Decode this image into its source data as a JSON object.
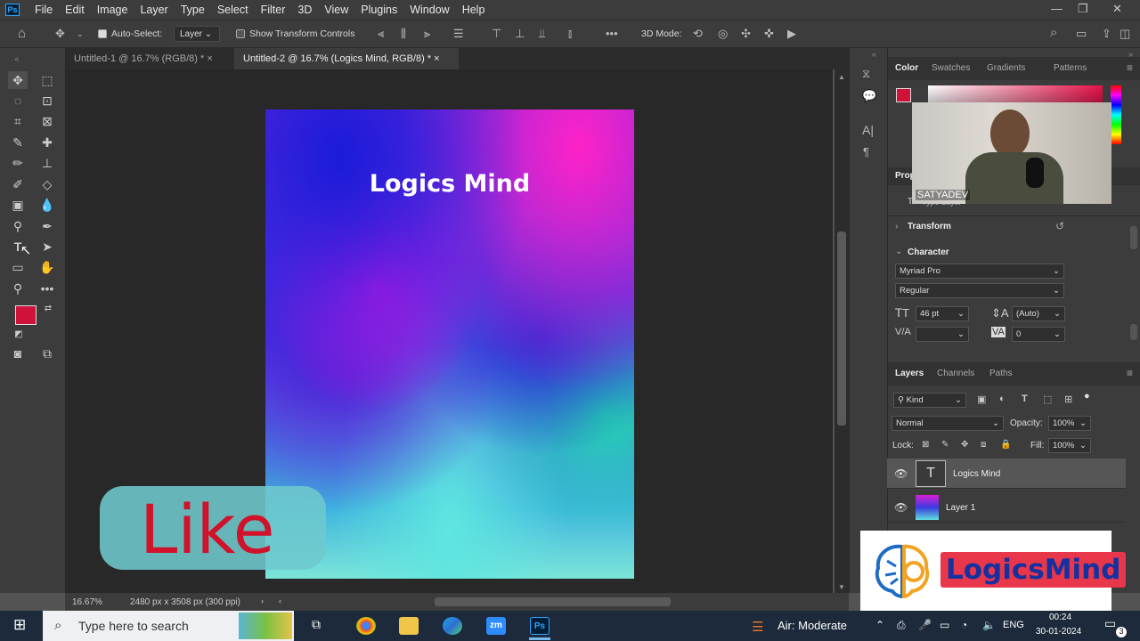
{
  "app": {
    "logo": "Ps",
    "menu": [
      "File",
      "Edit",
      "Image",
      "Layer",
      "Type",
      "Select",
      "Filter",
      "3D",
      "View",
      "Plugins",
      "Window",
      "Help"
    ],
    "window_controls": [
      "minimize-icon",
      "restore-icon",
      "close-icon"
    ]
  },
  "options": {
    "auto_select_label": "Auto-Select:",
    "auto_select_value": "Layer",
    "show_transform_label": "Show Transform Controls",
    "mode_3d": "3D Mode:"
  },
  "tabs": [
    {
      "label": "Untitled-1 @ 16.7% (RGB/8) *",
      "close": "×",
      "active": false
    },
    {
      "label": "Untitled-2 @ 16.7% (Logics Mind, RGB/8) *",
      "close": "×",
      "active": true
    }
  ],
  "canvas": {
    "title_text": "Logics Mind"
  },
  "status": {
    "zoom": "16.67%",
    "doc_size": "2480 px x 3508 px (300 ppi)"
  },
  "colors": {
    "foreground": "#d0123a",
    "background": "#ffffff"
  },
  "overlay": {
    "like_text": "Like",
    "webcam_name": "SATYADEV",
    "logo_text": "LogicsMind"
  },
  "panels": {
    "color_tabs": [
      "Color",
      "Swatches",
      "Gradients",
      "Patterns"
    ],
    "properties_label": "Prop",
    "properties_sub": "Type Layer",
    "transform_label": "Transform",
    "character_label": "Character",
    "font_family": "Myriad Pro",
    "font_style": "Regular",
    "font_size": "46 pt",
    "leading": "(Auto)",
    "tracking": "0",
    "kerning": "",
    "layers_tabs": [
      "Layers",
      "Channels",
      "Paths"
    ],
    "filter_kind": "Kind",
    "blend_mode": "Normal",
    "opacity_label": "Opacity:",
    "opacity_value": "100%",
    "lock_label": "Lock:",
    "fill_label": "Fill:",
    "fill_value": "100%",
    "layers": [
      {
        "name": "Logics Mind",
        "thumb": "T",
        "selected": true
      },
      {
        "name": "Layer 1",
        "thumb": "",
        "selected": false
      }
    ]
  },
  "taskbar": {
    "search_placeholder": "Type here to search",
    "weather": "Air: Moderate",
    "language": "ENG",
    "time": "00:24",
    "date": "30-01-2024",
    "notifications": "3",
    "apps": [
      "task-view-icon",
      "chrome-icon",
      "file-explorer-icon",
      "edge-icon",
      "zoom-icon",
      "photoshop-icon"
    ]
  }
}
